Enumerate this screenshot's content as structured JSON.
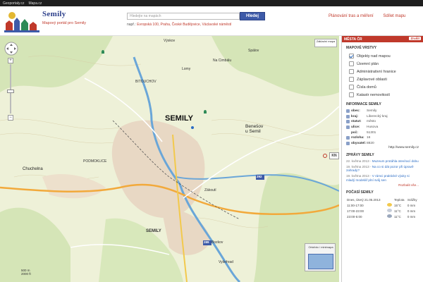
{
  "topbar": {
    "links": [
      "Geoportaly.cz",
      "Mapa.cz"
    ]
  },
  "header": {
    "brand": "Semily",
    "subtitle": "Mapový portál pro Semily",
    "search_placeholder": "Hledejte na mapách",
    "search_button": "Hledej",
    "hint_prefix": "např.:",
    "hint_examples": "Evropská 100, Praha, České Budějovice, Václavské náměstí",
    "link_route": "Plánování tras a měření",
    "link_share": "Sdílet mapu"
  },
  "map": {
    "labels": {
      "town": "SEMILY",
      "benesov": "Benešov u Semil",
      "chuchelna": "Chuchelna",
      "podmoklice": "PODMOKLICE",
      "bitouchov": "BITOUCHOV",
      "semily_small": "SEMILY",
      "road_292": "292",
      "road_289": "289",
      "kn": "KN",
      "basemap": "Základní mapa",
      "minimap": "Ortofoto / minimapa",
      "scale_m": "500 m",
      "scale_ft": "2000 ft",
      "vyskov": "Výskov",
      "spalov": "Spálov",
      "cimbal": "Na Cimbálu",
      "lomy": "Lomy",
      "zakouti": "Zákoutí",
      "bozkov": "Bozkov",
      "vysehrad": "Vyšehrad"
    }
  },
  "panel": {
    "header": "MĚSTA ČR",
    "close": "Zrušit",
    "layers_title": "MAPOVÉ VRSTVY",
    "layers": [
      {
        "label": "Objekty nad mapou",
        "checked": true
      },
      {
        "label": "Územní plán",
        "checked": false
      },
      {
        "label": "Administrativní hranice",
        "checked": false
      },
      {
        "label": "Záplavové oblasti",
        "checked": false
      },
      {
        "label": "Čísla domů",
        "checked": false
      },
      {
        "label": "Katastr nemovitostí",
        "checked": false
      }
    ],
    "info_title": "INFORMACE Semily",
    "info": [
      {
        "k": "obec:",
        "v": "Semily"
      },
      {
        "k": "kraj:",
        "v": "Liberecký kraj"
      },
      {
        "k": "statut:",
        "v": "město"
      },
      {
        "k": "ulice:",
        "v": "Husova"
      },
      {
        "k": "psč:",
        "v": "51301"
      },
      {
        "k": "rozloha:",
        "v": "16"
      },
      {
        "k": "obyvatel:",
        "v": "8820"
      }
    ],
    "web": "http://www.semily.cz",
    "news_title": "ZPRÁVY Semily",
    "news": [
      {
        "d": "22. května 2013 -",
        "t": "Muzeum protáhla otevírací dobu"
      },
      {
        "d": "19. května 2013 -",
        "t": "Na co si dát pozor při úpravě zahrady?"
      },
      {
        "d": "19. května 2013 -",
        "t": "V rámci praktické výuky si mladý modelář plní svůj sen"
      }
    ],
    "news_more": "Rozbalit vše...",
    "weather_title": "POČASÍ Semily",
    "weather_head": [
      "Dnes, Úterý 21.05.2013",
      "",
      "Teplota",
      "Srážky"
    ],
    "weather": [
      {
        "time": "11:00-17:00",
        "temp": "15°C",
        "rain": "0 mm"
      },
      {
        "time": "17:00-23:00",
        "temp": "11°C",
        "rain": "0 mm"
      },
      {
        "time": "23:00-5:00",
        "temp": "11°C",
        "rain": "0 mm"
      }
    ]
  }
}
